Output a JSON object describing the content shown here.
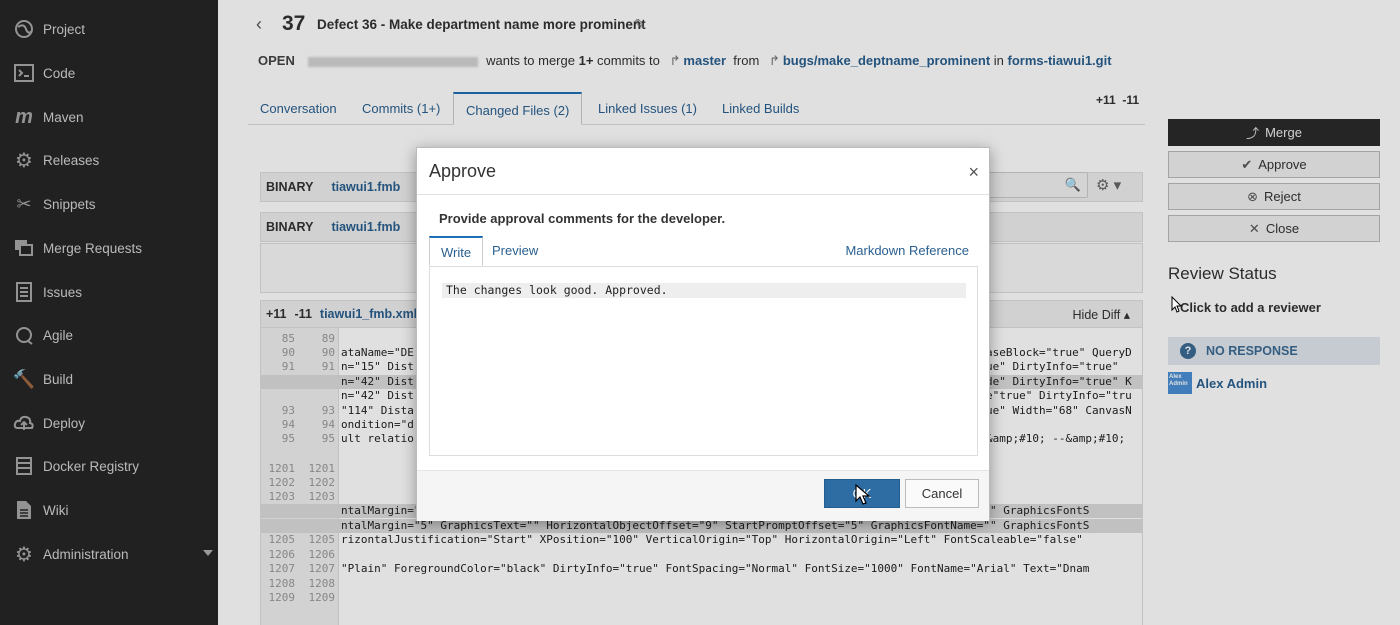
{
  "sidebar": {
    "items": [
      {
        "label": "Project",
        "icon": "project-icon"
      },
      {
        "label": "Code",
        "icon": "code-icon"
      },
      {
        "label": "Maven",
        "icon": "maven-icon"
      },
      {
        "label": "Releases",
        "icon": "gear-icon"
      },
      {
        "label": "Snippets",
        "icon": "snippets-icon"
      },
      {
        "label": "Merge Requests",
        "icon": "merge-requests-icon"
      },
      {
        "label": "Issues",
        "icon": "issues-icon"
      },
      {
        "label": "Agile",
        "icon": "agile-icon"
      },
      {
        "label": "Build",
        "icon": "build-icon"
      },
      {
        "label": "Deploy",
        "icon": "deploy-icon"
      },
      {
        "label": "Docker Registry",
        "icon": "docker-icon"
      },
      {
        "label": "Wiki",
        "icon": "wiki-icon"
      },
      {
        "label": "Administration",
        "icon": "administration-icon"
      }
    ]
  },
  "header": {
    "number": "37",
    "title": "Defect 36 - Make department name more prominent",
    "state": "OPEN",
    "merge_text": "wants to merge",
    "commits": "1+",
    "commits_to": "commits to",
    "target_branch": "master",
    "from": "from",
    "source_branch": "bugs/make_deptname_prominent",
    "in": "in",
    "repo": "forms-tiawui1.git"
  },
  "tabs": [
    {
      "label": "Conversation"
    },
    {
      "label": "Commits (1+)"
    },
    {
      "label": "Changed Files (2)",
      "active": true
    },
    {
      "label": "Linked Issues (1)"
    },
    {
      "label": "Linked Builds"
    }
  ],
  "diffstat": {
    "added": "+11",
    "removed": "-11"
  },
  "files": {
    "binary_kind": "BINARY",
    "binary_name_1": "tiawui1.fmb",
    "binary_name_2": "tiawui1.fmb",
    "xml_added": "+11",
    "xml_removed": "-11",
    "xml_name": "tiawui1_fmb.xml",
    "hide_diff": "Hide Diff"
  },
  "diff_lines": [
    {
      "l": "85",
      "r": "89",
      "code": "",
      "hl": false
    },
    {
      "l": "90",
      "r": "90",
      "code": "ataName=\"DE",
      "right": "aseBlock=\"true\" QueryD",
      "hl": false
    },
    {
      "l": "91",
      "r": "91",
      "code": "n=\"15\" Dist",
      "right": "ue\" DirtyInfo=\"true\"",
      "hl": false
    },
    {
      "l": "",
      "r": "",
      "code": "n=\"42\" Dist",
      "right": "de\" DirtyInfo=\"true\" K",
      "hl": true
    },
    {
      "l": "",
      "r": "",
      "code": "n=\"42\" Dist",
      "right": "e\"true\" DirtyInfo=\"tru",
      "hl": false
    },
    {
      "l": "93",
      "r": "93",
      "code": "\"114\" Dista",
      "right": "ue\" Width=\"68\" CanvasN",
      "hl": false
    },
    {
      "l": "94",
      "r": "94",
      "code": "ondition=\"d",
      "right": "",
      "hl": false
    },
    {
      "l": "95",
      "r": "95",
      "code": "ult relatio",
      "right": "&amp;#10;  --&amp;#10;",
      "hl": false
    },
    {
      "l": "",
      "r": "",
      "code": "",
      "hl": false
    },
    {
      "l": "1201",
      "r": "1201",
      "code": "",
      "hl": false
    },
    {
      "l": "1202",
      "r": "1202",
      "code": "",
      "hl": false
    },
    {
      "l": "1203",
      "r": "1203",
      "code": "",
      "hl": false
    },
    {
      "l": "",
      "r": "",
      "code": "ntalMargin=\"5\" GraphicsText=\"\" HorizontalObjectOffset=\"9\" StartPromptOffset=\"5\" GraphicsFontName=\"\" GraphicsFontS",
      "hl": true
    },
    {
      "l": "",
      "r": "",
      "code": "ntalMargin=\"5\" GraphicsText=\"\" HorizontalObjectOffset=\"9\" StartPromptOffset=\"5\" GraphicsFontName=\"\" GraphicsFontS",
      "hl": true
    },
    {
      "l": "1205",
      "r": "1205",
      "code": "rizontalJustification=\"Start\" XPosition=\"100\" VerticalOrigin=\"Top\" HorizontalOrigin=\"Left\" FontScaleable=\"false\"",
      "hl": false
    },
    {
      "l": "1206",
      "r": "1206",
      "code": "",
      "hl": false
    },
    {
      "l": "1207",
      "r": "1207",
      "code": "\"Plain\" ForegroundColor=\"black\" DirtyInfo=\"true\" FontSpacing=\"Normal\" FontSize=\"1000\" FontName=\"Arial\" Text=\"Dnam",
      "hl": false
    },
    {
      "l": "1208",
      "r": "1208",
      "code": "",
      "hl": false
    },
    {
      "l": "1209",
      "r": "1209",
      "code": "",
      "hl": false
    }
  ],
  "actions": {
    "merge": "Merge",
    "approve": "Approve",
    "reject": "Reject",
    "close": "Close"
  },
  "review": {
    "title": "Review Status",
    "add_reviewer": "Click to add a reviewer",
    "status": "NO RESPONSE",
    "reviewer_name": "Alex Admin",
    "avatar_text": "Alex Admin"
  },
  "modal": {
    "title": "Approve",
    "close_glyph": "×",
    "instruction": "Provide approval comments for the developer.",
    "tab_write": "Write",
    "tab_preview": "Preview",
    "markdown_ref": "Markdown Reference",
    "comment": "The changes look good. Approved.",
    "ok": "OK",
    "cancel": "Cancel"
  },
  "colors": {
    "sidebar_bg": "#262626",
    "link": "#2a5f8f",
    "primary_button": "#2e6ca4"
  }
}
